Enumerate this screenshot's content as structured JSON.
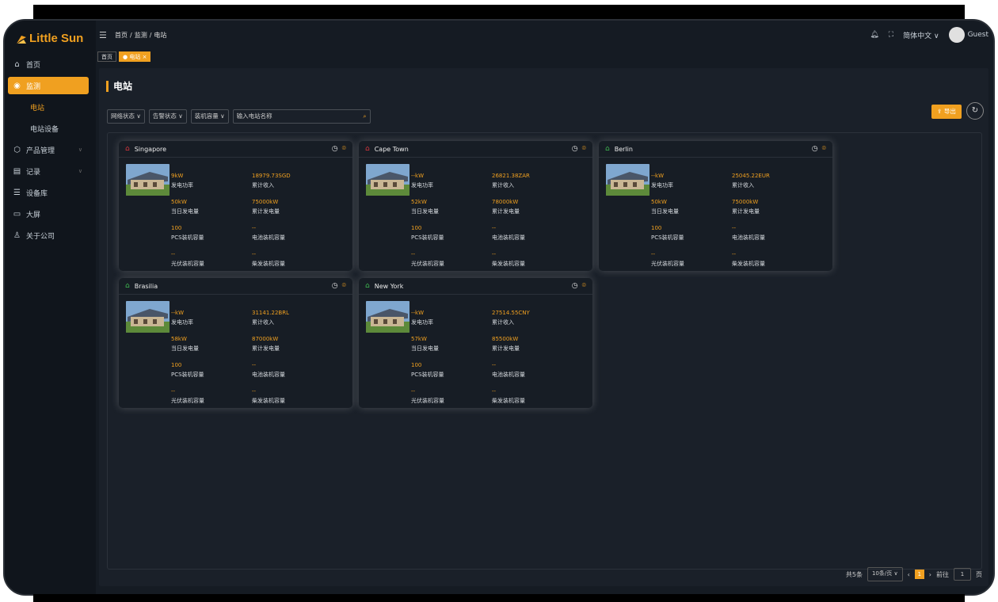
{
  "app": {
    "name": "Little Sun"
  },
  "sidebar": {
    "items": [
      {
        "label": "首页"
      },
      {
        "label": "监测"
      },
      {
        "label": "电站"
      },
      {
        "label": "电站设备"
      },
      {
        "label": "产品管理"
      },
      {
        "label": "记录"
      },
      {
        "label": "设备库"
      },
      {
        "label": "大屏"
      },
      {
        "label": "关于公司"
      }
    ]
  },
  "header": {
    "breadcrumb": [
      "首页",
      "监测",
      "电站"
    ],
    "language": "简体中文",
    "user": "Guest"
  },
  "tabs": [
    {
      "label": "首页"
    },
    {
      "label": "电站"
    }
  ],
  "page": {
    "title": "电站"
  },
  "filters": {
    "network": "网络状态",
    "alarm": "告警状态",
    "capacity": "装机容量",
    "search_placeholder": "输入电站名称"
  },
  "actions": {
    "export": "导出"
  },
  "labels": {
    "power": "发电功率",
    "income": "累计收入",
    "today": "当日发电量",
    "total": "累计发电量",
    "pcs": "PCS装机容量",
    "battery": "电池装机容量",
    "pv": "光伏装机容量",
    "diesel": "柴发装机容量"
  },
  "stations": [
    {
      "name": "Singapore",
      "status": "offline",
      "power": "9kW",
      "income": "18979.73SGD",
      "today": "50kW",
      "total": "75000kW",
      "pcs": "100",
      "battery": "--",
      "pv": "--",
      "diesel": "--"
    },
    {
      "name": "Cape Town",
      "status": "offline",
      "power": "--kW",
      "income": "26821.38ZAR",
      "today": "52kW",
      "total": "78000kW",
      "pcs": "100",
      "battery": "--",
      "pv": "--",
      "diesel": "--"
    },
    {
      "name": "Berlin",
      "status": "online",
      "power": "--kW",
      "income": "25045.22EUR",
      "today": "50kW",
      "total": "75000kW",
      "pcs": "100",
      "battery": "--",
      "pv": "--",
      "diesel": "--"
    },
    {
      "name": "Brasilia",
      "status": "online",
      "power": "--kW",
      "income": "31141.22BRL",
      "today": "58kW",
      "total": "87000kW",
      "pcs": "100",
      "battery": "--",
      "pv": "--",
      "diesel": "--"
    },
    {
      "name": "New York",
      "status": "online",
      "power": "--kW",
      "income": "27514.55CNY",
      "today": "57kW",
      "total": "85500kW",
      "pcs": "100",
      "battery": "--",
      "pv": "--",
      "diesel": "--"
    }
  ],
  "pagination": {
    "total": "共5条",
    "page_size": "10条/页",
    "current": "1",
    "goto_label": "前往",
    "goto_value": "1",
    "page_suffix": "页"
  },
  "colors": {
    "accent": "#f0a020",
    "offline": "#d9363e",
    "online": "#3fb950"
  }
}
